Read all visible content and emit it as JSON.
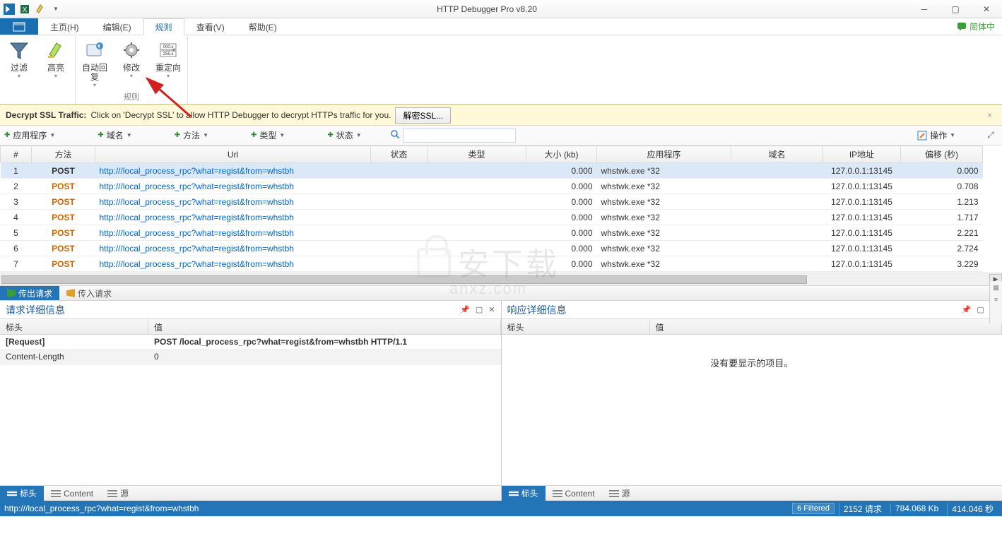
{
  "title": "HTTP Debugger Pro v8.20",
  "language_label": "简体中",
  "menu": {
    "tabs": [
      "主页(H)",
      "编辑(E)",
      "规则",
      "查看(V)",
      "帮助(E)"
    ],
    "active_index": 2
  },
  "ribbon": {
    "groups": [
      {
        "label": "",
        "buttons": [
          {
            "label": "过滤",
            "dropdown": true
          },
          {
            "label": "高亮",
            "dropdown": true
          }
        ]
      },
      {
        "label": "规则",
        "buttons": [
          {
            "label": "自动回复",
            "dropdown": true
          },
          {
            "label": "修改",
            "dropdown": true
          },
          {
            "label": "重定向",
            "dropdown": true
          }
        ]
      }
    ]
  },
  "banner": {
    "title": "Decrypt SSL Traffic:",
    "text": "Click on 'Decrypt SSL' to allow HTTP Debugger to decrypt HTTPs traffic for you.",
    "button": "解密SSL..."
  },
  "filterbar": {
    "buttons": [
      "应用程序",
      "域名",
      "方法",
      "类型",
      "状态"
    ],
    "operation_label": "操作",
    "search_placeholder": ""
  },
  "grid": {
    "columns": [
      "#",
      "方法",
      "Url",
      "状态",
      "类型",
      "大小 (kb)",
      "应用程序",
      "域名",
      "IP地址",
      "偏移 (秒)"
    ],
    "rows": [
      {
        "idx": 1,
        "method": "POST",
        "url": "http:///local_process_rpc?what=regist&from=whstbh",
        "status": "",
        "type": "",
        "size": "0.000",
        "app": "whstwk.exe *32",
        "domain": "",
        "ip": "127.0.0.1:13145",
        "offset": "0.000",
        "selected": true
      },
      {
        "idx": 2,
        "method": "POST",
        "url": "http:///local_process_rpc?what=regist&from=whstbh",
        "status": "",
        "type": "",
        "size": "0.000",
        "app": "whstwk.exe *32",
        "domain": "",
        "ip": "127.0.0.1:13145",
        "offset": "0.708"
      },
      {
        "idx": 3,
        "method": "POST",
        "url": "http:///local_process_rpc?what=regist&from=whstbh",
        "status": "",
        "type": "",
        "size": "0.000",
        "app": "whstwk.exe *32",
        "domain": "",
        "ip": "127.0.0.1:13145",
        "offset": "1.213"
      },
      {
        "idx": 4,
        "method": "POST",
        "url": "http:///local_process_rpc?what=regist&from=whstbh",
        "status": "",
        "type": "",
        "size": "0.000",
        "app": "whstwk.exe *32",
        "domain": "",
        "ip": "127.0.0.1:13145",
        "offset": "1.717"
      },
      {
        "idx": 5,
        "method": "POST",
        "url": "http:///local_process_rpc?what=regist&from=whstbh",
        "status": "",
        "type": "",
        "size": "0.000",
        "app": "whstwk.exe *32",
        "domain": "",
        "ip": "127.0.0.1:13145",
        "offset": "2.221"
      },
      {
        "idx": 6,
        "method": "POST",
        "url": "http:///local_process_rpc?what=regist&from=whstbh",
        "status": "",
        "type": "",
        "size": "0.000",
        "app": "whstwk.exe *32",
        "domain": "",
        "ip": "127.0.0.1:13145",
        "offset": "2.724"
      },
      {
        "idx": 7,
        "method": "POST",
        "url": "http:///local_process_rpc?what=regist&from=whstbh",
        "status": "",
        "type": "",
        "size": "0.000",
        "app": "whstwk.exe *32",
        "domain": "",
        "ip": "127.0.0.1:13145",
        "offset": "3.229"
      }
    ]
  },
  "midtabs": {
    "out": "传出请求",
    "in": "传入请求"
  },
  "details": {
    "request": {
      "title": "请求详细信息",
      "header_cols": [
        "标头",
        "值"
      ],
      "rows": [
        {
          "k": "[Request]",
          "v": "POST /local_process_rpc?what=regist&from=whstbh HTTP/1.1",
          "bold": true
        },
        {
          "k": "Content-Length",
          "v": "0"
        }
      ]
    },
    "response": {
      "title": "响应详细信息",
      "header_cols": [
        "标头",
        "值"
      ],
      "empty_text": "没有要显示的项目。"
    },
    "bottom_tabs": [
      "标头",
      "Content",
      "源"
    ]
  },
  "statusbar": {
    "url": "http:///local_process_rpc?what=regist&from=whstbh",
    "filtered": "6 Filtered",
    "requests": "2152 请求",
    "size": "784.068 Kb",
    "time": "414.046 秒"
  },
  "watermark": {
    "line1": "安下载",
    "line2": "anxz.com"
  }
}
